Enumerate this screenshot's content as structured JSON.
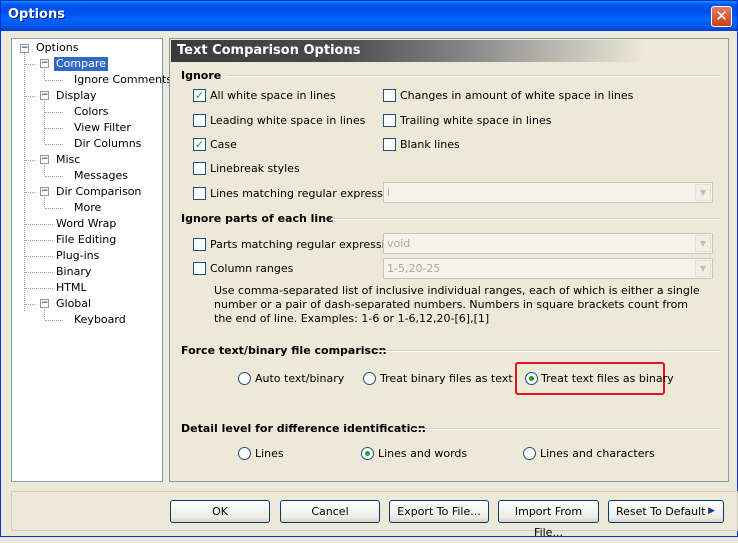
{
  "window": {
    "title": "Options",
    "close_symbol": "✕"
  },
  "tree": {
    "root": "Options",
    "compare": "Compare",
    "ignore_comments": "Ignore Comments",
    "display": "Display",
    "colors": "Colors",
    "view_filter": "View Filter",
    "dir_columns": "Dir Columns",
    "misc": "Misc",
    "messages": "Messages",
    "dir_comparison": "Dir Comparison",
    "more": "More",
    "word_wrap": "Word Wrap",
    "file_editing": "File Editing",
    "plugins": "Plug-ins",
    "binary": "Binary",
    "html": "HTML",
    "global": "Global",
    "keyboard": "Keyboard"
  },
  "panel": {
    "header": "Text Comparison Options",
    "ignore": {
      "title": "Ignore",
      "all_white_space": {
        "label": "All white space in lines",
        "checked": true
      },
      "changes_amount": {
        "label": "Changes in amount of white space in lines",
        "checked": false
      },
      "leading_white": {
        "label": "Leading white space in lines",
        "checked": false
      },
      "trailing_white": {
        "label": "Trailing white space in lines",
        "checked": false
      },
      "case": {
        "label": "Case",
        "checked": true
      },
      "blank_lines": {
        "label": "Blank lines",
        "checked": false
      },
      "linebreak": {
        "label": "Linebreak styles",
        "checked": false
      },
      "lines_matching": {
        "label": "Lines matching regular expression",
        "checked": false,
        "value": "i"
      }
    },
    "ignore_parts": {
      "title": "Ignore parts of each line",
      "parts_matching": {
        "label": "Parts matching regular expression",
        "checked": false,
        "value": "void"
      },
      "column_ranges": {
        "label": "Column ranges",
        "checked": false,
        "value": "1-5,20-25"
      },
      "note": "Use comma-separated list of inclusive individual ranges, each of which is either a single number or a pair of dash-separated numbers. Numbers in square brackets count from the end of line. Examples: 1-6 or 1-6,12,20-[6],[1]"
    },
    "force": {
      "title": "Force text/binary file comparison",
      "auto": "Auto text/binary",
      "binary_as_text": "Treat binary files as text",
      "text_as_binary": "Treat text files as binary",
      "selected": "text_as_binary"
    },
    "detail": {
      "title": "Detail level for difference identification",
      "lines": "Lines",
      "lines_words": "Lines and words",
      "lines_chars": "Lines and characters",
      "selected": "lines_words"
    }
  },
  "buttons": {
    "ok": "OK",
    "cancel": "Cancel",
    "export": "Export To File...",
    "import": "Import From File...",
    "reset": "Reset To Default",
    "reset_arrow": "▶"
  },
  "colors": {
    "titlebar": "#0053ee",
    "selection": "#316ac5",
    "highlight_box": "#e0141a",
    "check": "#21a121"
  }
}
